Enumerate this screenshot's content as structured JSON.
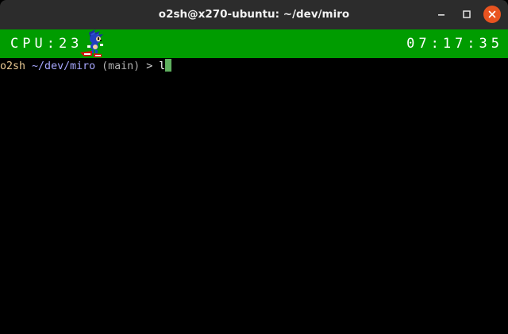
{
  "window": {
    "title": "o2sh@x270-ubuntu: ~/dev/miro",
    "close_color": "#e95420"
  },
  "statusbar": {
    "cpu": "CPU:23",
    "clock": "07:17:35",
    "background": "#009c00",
    "sprite_icon": "sonic-hedgehog-sprite"
  },
  "terminal": {
    "user": "o2sh",
    "path": "~/dev/miro",
    "branch": "(main)",
    "prompt_symbol": ">",
    "input": "l"
  }
}
